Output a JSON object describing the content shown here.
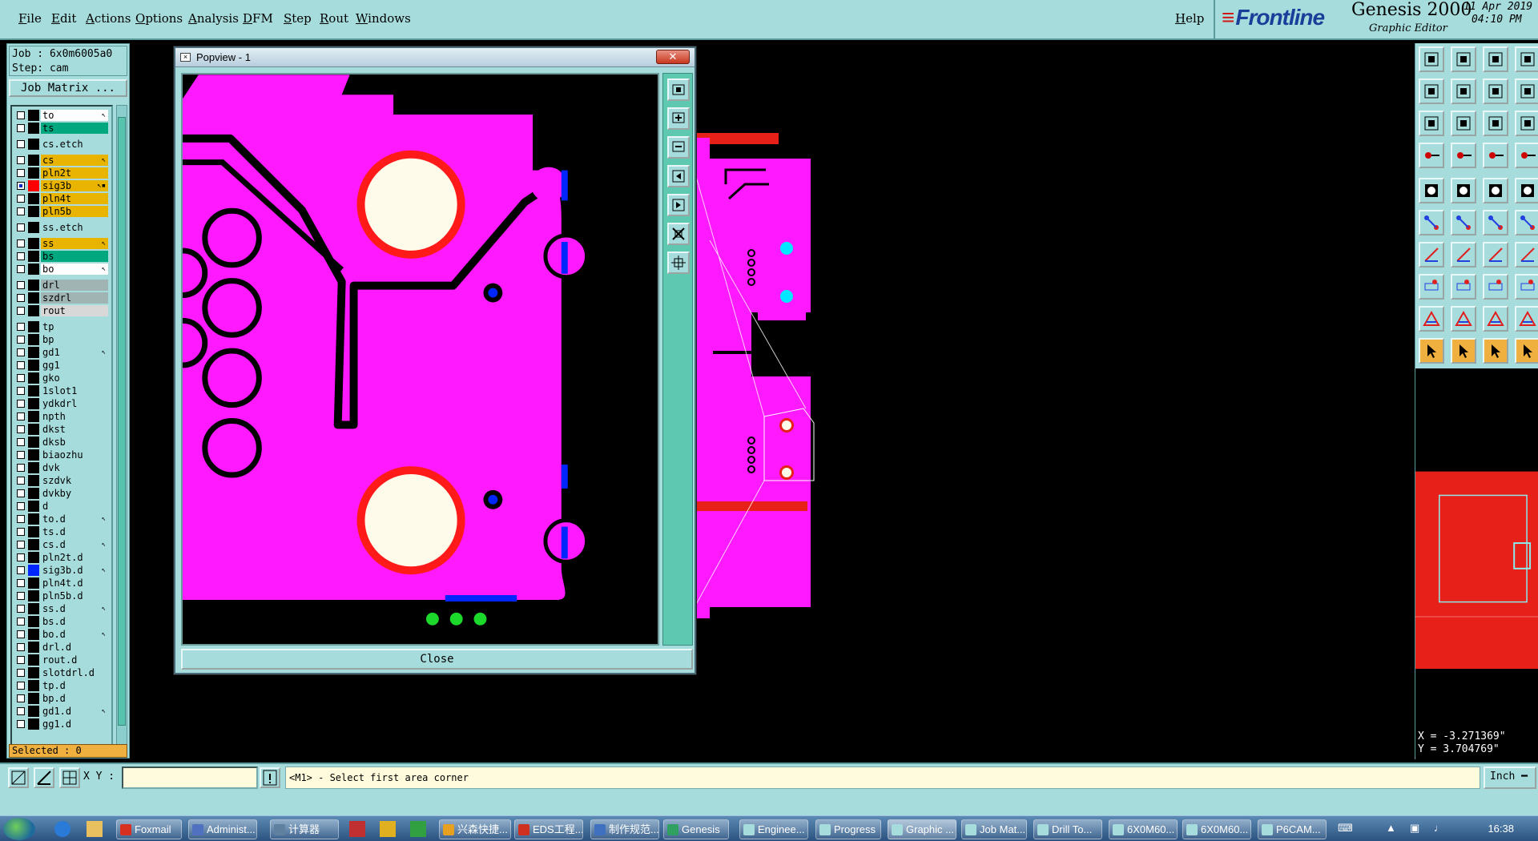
{
  "menu": [
    "File",
    "Edit",
    "Actions",
    "Options",
    "Analysis",
    "DFM",
    "Step",
    "Rout",
    "Windows"
  ],
  "help": "Help",
  "brand": {
    "logo": "Frontline",
    "title": "Genesis 2000",
    "subtitle": "Graphic Editor",
    "date": "11 Apr 2019",
    "time": "04:10 PM"
  },
  "job": {
    "name": "Job : 6x0m6005a0",
    "step": "Step: cam",
    "matrix_button": "Job Matrix ..."
  },
  "layers": [
    {
      "name": "to",
      "bg": "#ffffff",
      "flag": "↖"
    },
    {
      "name": "ts",
      "bg": "#00a880",
      "flag": ""
    },
    {
      "name": "cs.etch",
      "bg": "#a6dcdc",
      "flag": "",
      "gap": true
    },
    {
      "name": "cs",
      "bg": "#e8b400",
      "flag": "↖",
      "gap": true
    },
    {
      "name": "pln2t",
      "bg": "#e8b400",
      "flag": ""
    },
    {
      "name": "sig3b",
      "bg": "#e8b400",
      "flag": "↖▪",
      "color": "#ff0000",
      "checked": true
    },
    {
      "name": "pln4t",
      "bg": "#e8b400",
      "flag": ""
    },
    {
      "name": "pln5b",
      "bg": "#e8b400",
      "flag": ""
    },
    {
      "name": "ss.etch",
      "bg": "#a6dcdc",
      "flag": "",
      "gap": true
    },
    {
      "name": "ss",
      "bg": "#e8b400",
      "flag": "↖",
      "gap": true
    },
    {
      "name": "bs",
      "bg": "#00a880",
      "flag": ""
    },
    {
      "name": "bo",
      "bg": "#ffffff",
      "flag": "↖"
    },
    {
      "name": "drl",
      "bg": "#a0b4b4",
      "flag": "",
      "gap": true
    },
    {
      "name": "szdrl",
      "bg": "#a0b4b4",
      "flag": ""
    },
    {
      "name": "rout",
      "bg": "#d8d8d8",
      "flag": ""
    },
    {
      "name": "tp",
      "bg": "#a6dcdc",
      "flag": "",
      "gap": true
    },
    {
      "name": "bp",
      "bg": "#a6dcdc",
      "flag": ""
    },
    {
      "name": "gd1",
      "bg": "#a6dcdc",
      "flag": "↖"
    },
    {
      "name": "gg1",
      "bg": "#a6dcdc",
      "flag": ""
    },
    {
      "name": "gko",
      "bg": "#a6dcdc",
      "flag": ""
    },
    {
      "name": "1slot1",
      "bg": "#a6dcdc",
      "flag": ""
    },
    {
      "name": "ydkdrl",
      "bg": "#a6dcdc",
      "flag": ""
    },
    {
      "name": "npth",
      "bg": "#a6dcdc",
      "flag": ""
    },
    {
      "name": "dkst",
      "bg": "#a6dcdc",
      "flag": ""
    },
    {
      "name": "dksb",
      "bg": "#a6dcdc",
      "flag": ""
    },
    {
      "name": "biaozhu",
      "bg": "#a6dcdc",
      "flag": ""
    },
    {
      "name": "dvk",
      "bg": "#a6dcdc",
      "flag": ""
    },
    {
      "name": "szdvk",
      "bg": "#a6dcdc",
      "flag": ""
    },
    {
      "name": "dvkby",
      "bg": "#a6dcdc",
      "flag": ""
    },
    {
      "name": "d",
      "bg": "#a6dcdc",
      "flag": ""
    },
    {
      "name": "to.d",
      "bg": "#a6dcdc",
      "flag": "↖"
    },
    {
      "name": "ts.d",
      "bg": "#a6dcdc",
      "flag": ""
    },
    {
      "name": "cs.d",
      "bg": "#a6dcdc",
      "flag": "↖"
    },
    {
      "name": "pln2t.d",
      "bg": "#a6dcdc",
      "flag": ""
    },
    {
      "name": "sig3b.d",
      "bg": "#a6dcdc",
      "flag": "↖",
      "color": "#0026ff"
    },
    {
      "name": "pln4t.d",
      "bg": "#a6dcdc",
      "flag": ""
    },
    {
      "name": "pln5b.d",
      "bg": "#a6dcdc",
      "flag": ""
    },
    {
      "name": "ss.d",
      "bg": "#a6dcdc",
      "flag": "↖"
    },
    {
      "name": "bs.d",
      "bg": "#a6dcdc",
      "flag": ""
    },
    {
      "name": "bo.d",
      "bg": "#a6dcdc",
      "flag": "↖"
    },
    {
      "name": "drl.d",
      "bg": "#a6dcdc",
      "flag": ""
    },
    {
      "name": "rout.d",
      "bg": "#a6dcdc",
      "flag": ""
    },
    {
      "name": "slotdrl.d",
      "bg": "#a6dcdc",
      "flag": ""
    },
    {
      "name": "tp.d",
      "bg": "#a6dcdc",
      "flag": ""
    },
    {
      "name": "bp.d",
      "bg": "#a6dcdc",
      "flag": ""
    },
    {
      "name": "gd1.d",
      "bg": "#a6dcdc",
      "flag": "↖"
    },
    {
      "name": "gg1.d",
      "bg": "#a6dcdc",
      "flag": ""
    }
  ],
  "selected": "Selected : 0",
  "popview": {
    "title": "Popview - 1",
    "close_button": "Close"
  },
  "coords": {
    "x": "X = -3.271369\"",
    "y": "Y = 3.704769\""
  },
  "xy_label": "X Y :",
  "message": "<M1> - Select first area corner",
  "units": "Inch",
  "taskbar": [
    {
      "label": "Foxmail",
      "color": "#d83020"
    },
    {
      "label": "Administ...",
      "color": "#5070c0"
    },
    {
      "label": "计算器",
      "color": "#6080a0"
    },
    {
      "label": "兴森快捷...",
      "color": "#e8a020"
    },
    {
      "label": "EDS工程...",
      "color": "#d03020"
    },
    {
      "label": "制作规范...",
      "color": "#4070c0"
    },
    {
      "label": "Genesis",
      "color": "#30a060"
    },
    {
      "label": "Enginee...",
      "color": "#a6dcdc"
    },
    {
      "label": "Progress",
      "color": "#a6dcdc"
    },
    {
      "label": "Graphic ...",
      "color": "#a6dcdc",
      "active": true
    },
    {
      "label": "Job Mat...",
      "color": "#a6dcdc"
    },
    {
      "label": "Drill To...",
      "color": "#a6dcdc"
    },
    {
      "label": "6X0M60...",
      "color": "#a6dcdc"
    },
    {
      "label": "6X0M60...",
      "color": "#a6dcdc"
    },
    {
      "label": "P6CAM...",
      "color": "#a6dcdc"
    }
  ],
  "clock": "16:38"
}
